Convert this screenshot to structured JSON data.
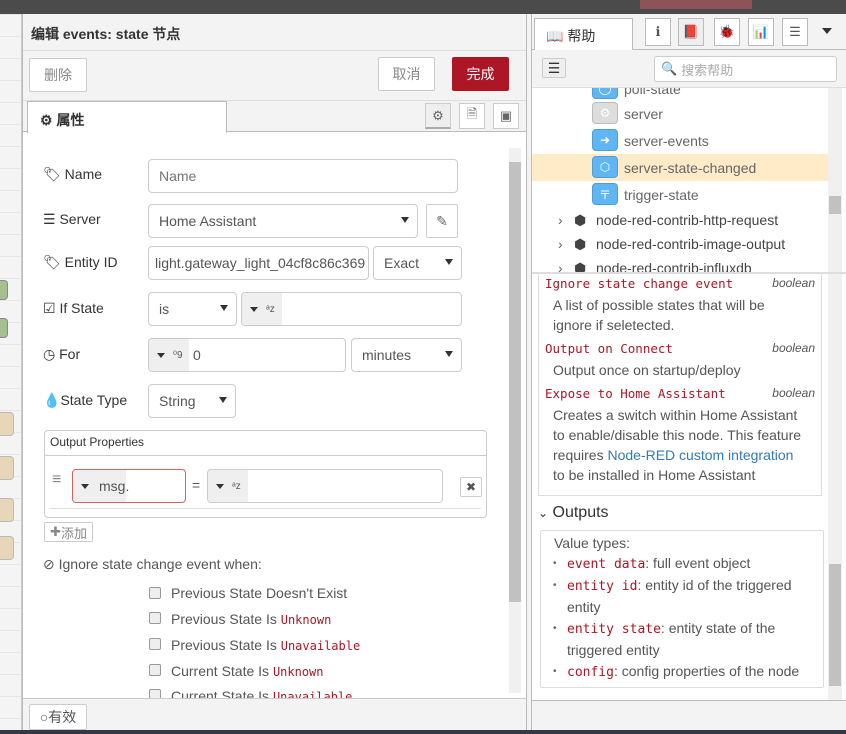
{
  "editor": {
    "title": "编辑 events: state 节点",
    "delete_label": "删除",
    "cancel_label": "取消",
    "done_label": "完成",
    "tab_properties": "属性",
    "fields": {
      "name": {
        "label": "Name",
        "placeholder": "Name",
        "value": ""
      },
      "server": {
        "label": "Server",
        "value": "Home Assistant"
      },
      "entity_id": {
        "label": "Entity ID",
        "value": "light.gateway_light_04cf8c86c369",
        "match": "Exact"
      },
      "if_state": {
        "label": "If State",
        "operator": "is",
        "type": "a-z",
        "value": "",
        "checked": true
      },
      "for": {
        "label": "For",
        "type": "0-9",
        "value": "0",
        "unit": "minutes"
      },
      "state_type": {
        "label": "State Type",
        "value": "String"
      }
    },
    "output_properties": {
      "title": "Output Properties",
      "rows": [
        {
          "prefix": "msg.",
          "property": "",
          "equals": "=",
          "type": "a-z",
          "value": ""
        }
      ],
      "add_label": "添加"
    },
    "ignore": {
      "title": "Ignore state change event when:",
      "options": [
        {
          "text": "Previous State Doesn't Exist",
          "code": "",
          "checked": false
        },
        {
          "text": "Previous State Is ",
          "code": "Unknown",
          "checked": false
        },
        {
          "text": "Previous State Is ",
          "code": "Unavailable",
          "checked": false
        },
        {
          "text": "Current State Is ",
          "code": "Unknown",
          "checked": false
        },
        {
          "text": "Current State Is ",
          "code": "Unavailable",
          "checked": false
        }
      ]
    },
    "enabled_label": "有效"
  },
  "sidebar": {
    "tab_help": "帮助",
    "search_placeholder": "搜索帮助",
    "tree": [
      {
        "label": "poll-state",
        "icon": "poll-icon"
      },
      {
        "label": "server",
        "icon": "gear-icon"
      },
      {
        "label": "server-events",
        "icon": "arrow-right-icon"
      },
      {
        "label": "server-state-changed",
        "icon": "hexagon-arrow-icon",
        "selected": true
      },
      {
        "label": "trigger-state",
        "icon": "trigger-icon"
      }
    ],
    "packages": [
      "node-red-contrib-http-request",
      "node-red-contrib-image-output",
      "node-red-contrib-influxdb"
    ],
    "help": {
      "props": [
        {
          "name": "Ignore state change event",
          "type": "boolean",
          "desc": "A list of possible states that will be ignore if seletected."
        },
        {
          "name": "Output on Connect",
          "type": "boolean",
          "desc": "Output once on startup/deploy"
        },
        {
          "name": "Expose to Home Assistant",
          "type": "boolean",
          "desc_before": "Creates a switch within Home Assistant to enable/disable this node. This feature requires ",
          "link": "Node-RED custom integration",
          "desc_after": " to be installed in Home Assistant"
        }
      ],
      "outputs_title": "Outputs",
      "value_types": "Value types:",
      "outputs": [
        {
          "code": "event data",
          "text": ": full event object"
        },
        {
          "code": "entity id",
          "text": ": entity id of the triggered entity"
        },
        {
          "code": "entity state",
          "text": ": entity state of the triggered entity"
        },
        {
          "code": "config",
          "text": ": config properties of the node"
        }
      ]
    }
  },
  "colors": {
    "primary": "#ad1625",
    "selected_row": "#ffebc7",
    "node_blue": "#5fb6f2",
    "link": "#337ab7"
  }
}
